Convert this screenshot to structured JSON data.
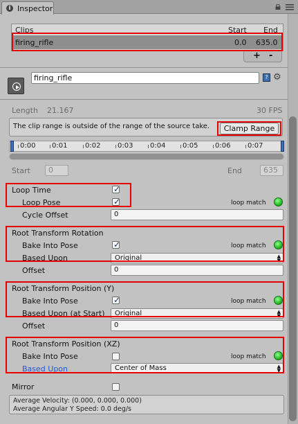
{
  "tab": {
    "label": "Inspector",
    "icon": "info-icon"
  },
  "clips": {
    "header": {
      "clips": "Clips",
      "start": "Start",
      "end": "End"
    },
    "rows": [
      {
        "name": "firing_rifle",
        "start": "0.0",
        "end": "635.0"
      }
    ],
    "add": "+",
    "remove": "-"
  },
  "clip_name": "firing_rifle",
  "length": {
    "label": "Length",
    "value": "21.167",
    "fps": "30 FPS"
  },
  "warning": {
    "text": "The clip range is outside of the range of the source take.",
    "button": "Clamp Range"
  },
  "timeline": {
    "ticks": [
      "0:00",
      "0:01",
      "0:02",
      "0:03",
      "0:04",
      "0:05",
      "0:06",
      "0:07"
    ]
  },
  "range": {
    "start_label": "Start",
    "start_value": "0",
    "end_label": "End",
    "end_value": "635"
  },
  "loop_match_label": "loop match",
  "loop": {
    "loop_time": {
      "label": "Loop Time",
      "checked": true
    },
    "loop_pose": {
      "label": "Loop Pose",
      "checked": true
    },
    "cycle_offset": {
      "label": "Cycle Offset",
      "value": "0"
    }
  },
  "rotation": {
    "title": "Root Transform Rotation",
    "bake": {
      "label": "Bake Into Pose",
      "checked": true
    },
    "based_upon": {
      "label": "Based Upon",
      "value": "Original"
    },
    "offset": {
      "label": "Offset",
      "value": "0"
    }
  },
  "position_y": {
    "title": "Root Transform Position (Y)",
    "bake": {
      "label": "Bake Into Pose",
      "checked": true
    },
    "based_upon": {
      "label": "Based Upon (at Start)",
      "value": "Original"
    },
    "offset": {
      "label": "Offset",
      "value": "0"
    }
  },
  "position_xz": {
    "title": "Root Transform Position (XZ)",
    "bake": {
      "label": "Bake Into Pose",
      "checked": false
    },
    "based_upon": {
      "label": "Based Upon",
      "value": "Center of Mass"
    }
  },
  "mirror": {
    "label": "Mirror",
    "checked": false
  },
  "info": {
    "velocity": "Average Velocity: (0.000, 0.000, 0.000)",
    "angular": "Average Angular Y Speed: 0.0 deg/s"
  },
  "colors": {
    "highlight_red": "#e60000",
    "loop_match_green": "#17b017",
    "blue_label": "#2356d6"
  }
}
